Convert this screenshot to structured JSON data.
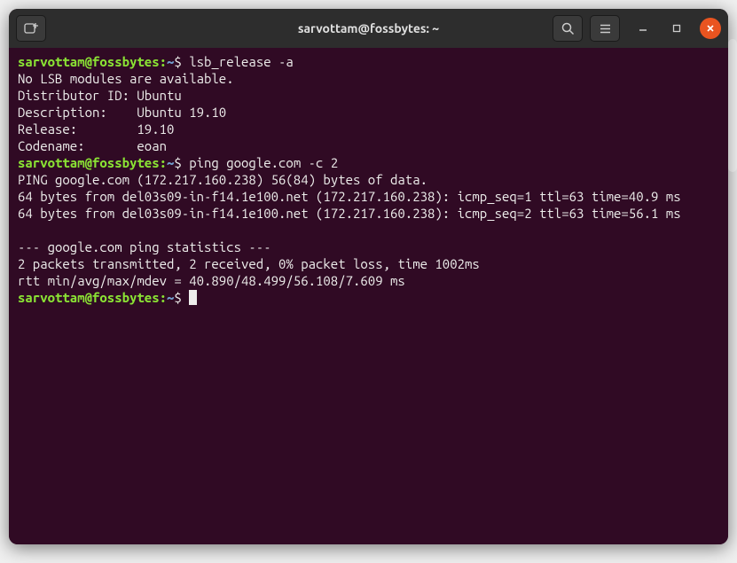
{
  "titlebar": {
    "title": "sarvottam@fossbytes: ~"
  },
  "prompt": {
    "userhost": "sarvottam@fossbytes",
    "path": "~",
    "symbol": "$"
  },
  "blocks": [
    {
      "command": "lsb_release -a",
      "output": "No LSB modules are available.\nDistributor ID:\tUbuntu\nDescription:\tUbuntu 19.10\nRelease:\t19.10\nCodename:\teoan"
    },
    {
      "command": "ping google.com -c 2",
      "output": "PING google.com (172.217.160.238) 56(84) bytes of data.\n64 bytes from del03s09-in-f14.1e100.net (172.217.160.238): icmp_seq=1 ttl=63 time=40.9 ms\n64 bytes from del03s09-in-f14.1e100.net (172.217.160.238): icmp_seq=2 ttl=63 time=56.1 ms\n\n--- google.com ping statistics ---\n2 packets transmitted, 2 received, 0% packet loss, time 1002ms\nrtt min/avg/max/mdev = 40.890/48.499/56.108/7.609 ms"
    }
  ]
}
